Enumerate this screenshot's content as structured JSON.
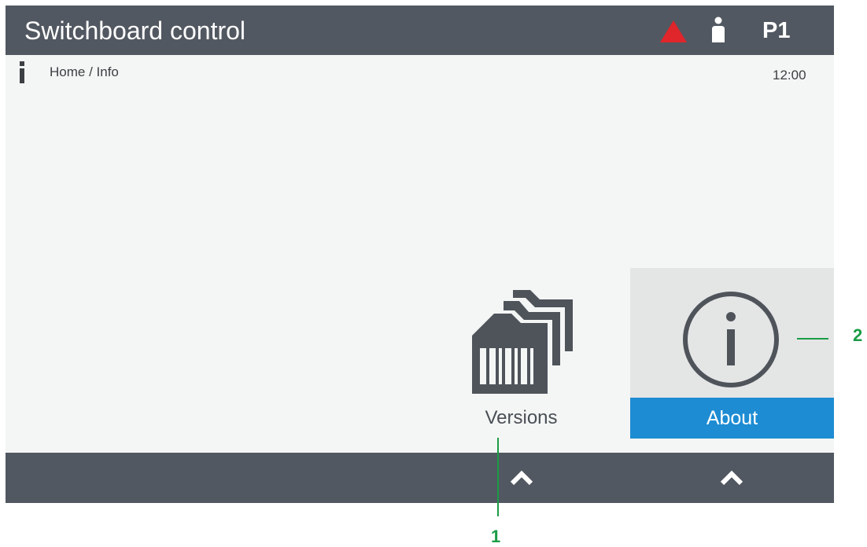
{
  "header": {
    "title": "Switchboard control",
    "profile_label": "P1",
    "alarm_icon": "warning-triangle-icon",
    "user_icon": "user-icon"
  },
  "subheader": {
    "breadcrumb": "Home / Info",
    "time": "12:00",
    "info_icon": "info-icon"
  },
  "tiles": [
    {
      "label": "Versions",
      "icon": "folders-icon",
      "selected": false
    },
    {
      "label": "About",
      "icon": "info-circle-icon",
      "selected": true
    }
  ],
  "footer": {
    "buttons": [
      {
        "icon": "chevron-up-icon"
      },
      {
        "icon": "chevron-up-icon"
      }
    ]
  },
  "callouts": [
    "1",
    "2"
  ],
  "colors": {
    "bar": "#525861",
    "background": "#f4f6f5",
    "accent": "#1d8cd3",
    "alarm": "#e0252b",
    "callout": "#1a9c46"
  }
}
